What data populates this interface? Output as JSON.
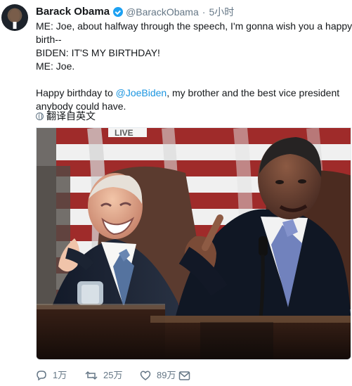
{
  "tweet": {
    "author_name": "Barack Obama",
    "handle": "@BarackObama",
    "separator": "·",
    "time": "5小时",
    "lines": [
      "ME:  Joe, about halfway through the speech, I'm gonna wish you a happy",
      "birth--",
      "BIDEN:  IT'S MY BIRTHDAY!",
      "ME:  Joe.",
      "",
      "Happy birthday to ",
      "@JoeBiden",
      ", my brother and the best vice president",
      "anybody could have."
    ],
    "translate_label": "翻译自英文",
    "media_live_label": "LIVE",
    "actions": {
      "reply_count": "1万",
      "retweet_count": "25万",
      "like_count": "89万"
    }
  },
  "colors": {
    "link": "#1b95e0",
    "secondary_text": "#657786",
    "verified": "#1da1f2"
  },
  "icons": [
    "verified-badge-icon",
    "globe-icon",
    "reply-icon",
    "retweet-icon",
    "like-icon",
    "direct-message-icon"
  ]
}
